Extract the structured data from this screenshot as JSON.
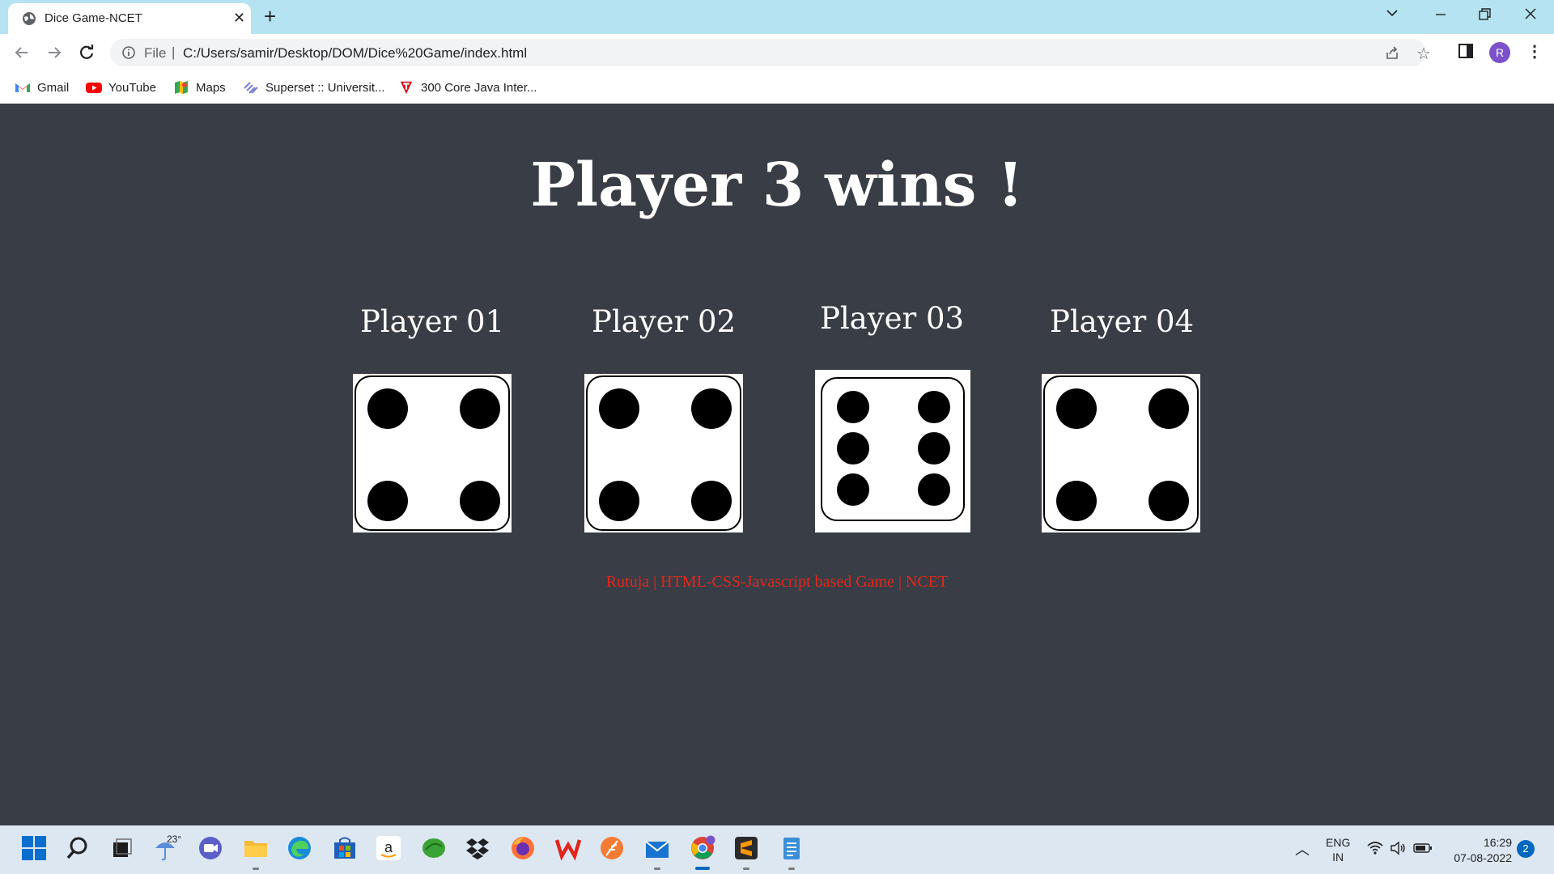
{
  "browser": {
    "tab": {
      "title": "Dice Game-NCET",
      "close": "✕"
    },
    "new_tab": "+",
    "address": {
      "scheme": "File",
      "separator": "|",
      "url": "C:/Users/samir/Desktop/DOM/Dice%20Game/index.html"
    },
    "profile_initial": "R",
    "bookmarks": [
      {
        "label": "Gmail",
        "icon": "gmail-icon"
      },
      {
        "label": "YouTube",
        "icon": "youtube-icon"
      },
      {
        "label": "Maps",
        "icon": "maps-icon"
      },
      {
        "label": "Superset :: Universit...",
        "icon": "superset-icon"
      },
      {
        "label": "300 Core Java Inter...",
        "icon": "javatpoint-icon"
      }
    ]
  },
  "page": {
    "result_title": "Player 3 wins !",
    "players": [
      {
        "label": "Player 01",
        "die_value": 4
      },
      {
        "label": "Player 02",
        "die_value": 4
      },
      {
        "label": "Player 03",
        "die_value": 6
      },
      {
        "label": "Player 04",
        "die_value": 4
      }
    ],
    "footer": "Rutuja | HTML-CSS-Javascript based Game | NCET"
  },
  "taskbar": {
    "weather_temp": "23°",
    "lang_top": "ENG",
    "lang_bottom": "IN",
    "time": "16:29",
    "date": "07-08-2022",
    "notifications": "2"
  },
  "colors": {
    "page_bg": "#393d46",
    "footer_text": "#e0281c",
    "tabbar_bg": "#b6e3f1"
  }
}
